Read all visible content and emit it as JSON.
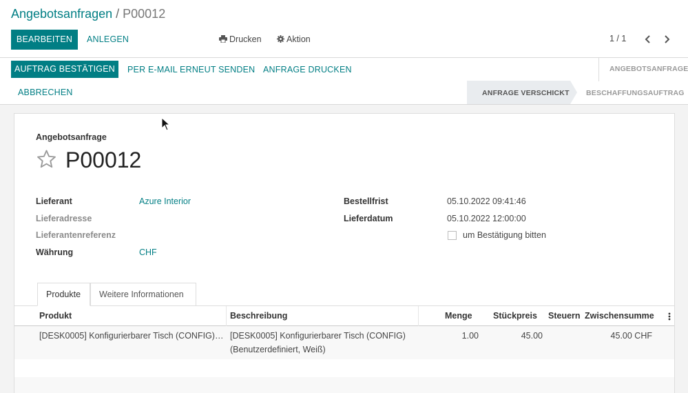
{
  "breadcrumb": {
    "parent": "Angebotsanfragen",
    "separator": "/",
    "current": "P00012"
  },
  "toolbar": {
    "edit_label": "Bearbeiten",
    "create_label": "Anlegen",
    "print_label": "Drucken",
    "action_label": "Aktion"
  },
  "pager": {
    "value": "1 / 1"
  },
  "statusbar": {
    "confirm_label": "Auftrag bestätigen",
    "resend_label": "Per E-Mail erneut senden",
    "print_rfq_label": "Anfrage drucken",
    "cancel_label": "Abbrechen",
    "stages": [
      "Angebotsanfrage",
      "Anfrage verschickt",
      "Beschaffungsauftrag"
    ],
    "active_stage": "Anfrage verschickt"
  },
  "form": {
    "doc_type": "Angebotsanfrage",
    "name": "P00012",
    "fields_left": [
      {
        "label": "Lieferant",
        "value": "Azure Interior"
      },
      {
        "label": "Lieferadresse",
        "value": ""
      },
      {
        "label": "Lieferantenreferenz",
        "value": ""
      },
      {
        "label": "Währung",
        "value": "CHF"
      }
    ],
    "fields_right": [
      {
        "label": "Bestellfrist",
        "value": "05.10.2022 09:41:46"
      },
      {
        "label": "Lieferdatum",
        "value": "05.10.2022 12:00:00"
      }
    ],
    "ask_confirmation_label": "um Bestätigung bitten",
    "ask_confirmation_checked": false
  },
  "tabs": [
    "Produkte",
    "Weitere Informationen"
  ],
  "lines": {
    "headers": [
      "Produkt",
      "Beschreibung",
      "Menge",
      "Stückpreis",
      "Steuern",
      "Zwischensumme"
    ],
    "rows": [
      {
        "product": "[DESK0005] Konfigurierbarer Tisch (CONFIG)…",
        "description_line1": "[DESK0005] Konfigurierbarer Tisch (CONFIG)",
        "description_line2": "(Benutzerdefiniert, Weiß)",
        "quantity": "1.00",
        "unit_price": "45.00",
        "taxes": "",
        "subtotal": "45.00 CHF"
      }
    ]
  },
  "colors": {
    "primary": "#017e84",
    "active_stage_bg": "#e9ecef"
  }
}
